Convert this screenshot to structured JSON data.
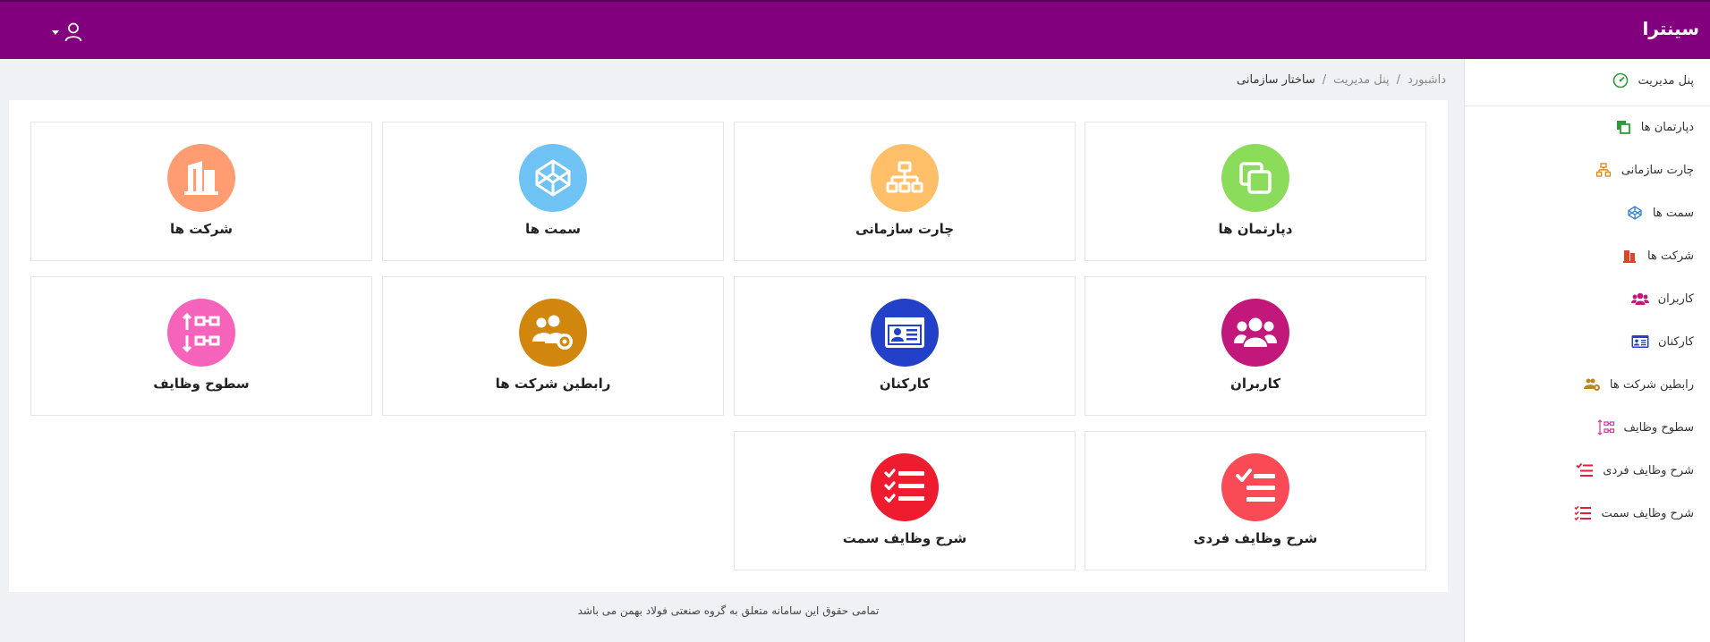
{
  "header": {
    "brand": "سینترا",
    "user_icon": "user-icon",
    "dropdown_icon": "caret-down-icon"
  },
  "breadcrumb": {
    "items": [
      "داشبورد",
      "پنل مدیریت"
    ],
    "current": "ساختار سازمانی",
    "separator": "/"
  },
  "sidebar": {
    "items": [
      {
        "label": "پنل مدیریت",
        "icon": "dashboard-gauge-icon",
        "color": "#2e9c3a"
      },
      {
        "label": "دپارتمان ها",
        "icon": "clone-icon",
        "color": "#2e9c3a"
      },
      {
        "label": "چارت سازمانی",
        "icon": "sitemap-icon",
        "color": "#e08a1e"
      },
      {
        "label": "سمت ها",
        "icon": "codepen-icon",
        "color": "#2a7fd4"
      },
      {
        "label": "شرکت ها",
        "icon": "building-icon",
        "color": "#e0452b"
      },
      {
        "label": "کاربران",
        "icon": "users-icon",
        "color": "#c2187c"
      },
      {
        "label": "کارکنان",
        "icon": "id-card-icon",
        "color": "#2340c9"
      },
      {
        "label": "رابطین شرکت ها",
        "icon": "users-cog-icon",
        "color": "#c4821a"
      },
      {
        "label": "سطوح وظایف",
        "icon": "hierarchy-levels-icon",
        "color": "#e0409a"
      },
      {
        "label": "شرح وظایف فردی",
        "icon": "checklist-icon",
        "color": "#e01f3d"
      },
      {
        "label": "شرح وظایف سمت",
        "icon": "checklist-icon",
        "color": "#e01f3d"
      }
    ]
  },
  "cards": [
    {
      "label": "دپارتمان ها",
      "icon": "clone-icon",
      "color": "#8cdc5c"
    },
    {
      "label": "چارت سازمانی",
      "icon": "sitemap-icon",
      "color": "#ffbf69"
    },
    {
      "label": "سمت ها",
      "icon": "codepen-icon",
      "color": "#6ec3f4"
    },
    {
      "label": "شرکت ها",
      "icon": "building-icon",
      "color": "#ff9c72"
    },
    {
      "label": "کاربران",
      "icon": "users-icon",
      "color": "#c2187c"
    },
    {
      "label": "کارکنان",
      "icon": "id-card-icon",
      "color": "#2340c9"
    },
    {
      "label": "رابطین شرکت ها",
      "icon": "users-cog-icon",
      "color": "#d1860e"
    },
    {
      "label": "سطوح وظایف",
      "icon": "hierarchy-levels-icon",
      "color": "#f564ba"
    },
    {
      "label": "شرح وظایف فردی",
      "icon": "checklist-icon",
      "color": "#fa4a55"
    },
    {
      "label": "شرح وظایف سمت",
      "icon": "checklist-icon",
      "color": "#ee1c2e"
    }
  ],
  "footer": {
    "text": "تمامی حقوق این سامانه متعلق به گروه صنعتی فولاد بهمن می باشد"
  },
  "colors": {
    "topbar": "#82007e",
    "background": "#f0f1f5"
  }
}
